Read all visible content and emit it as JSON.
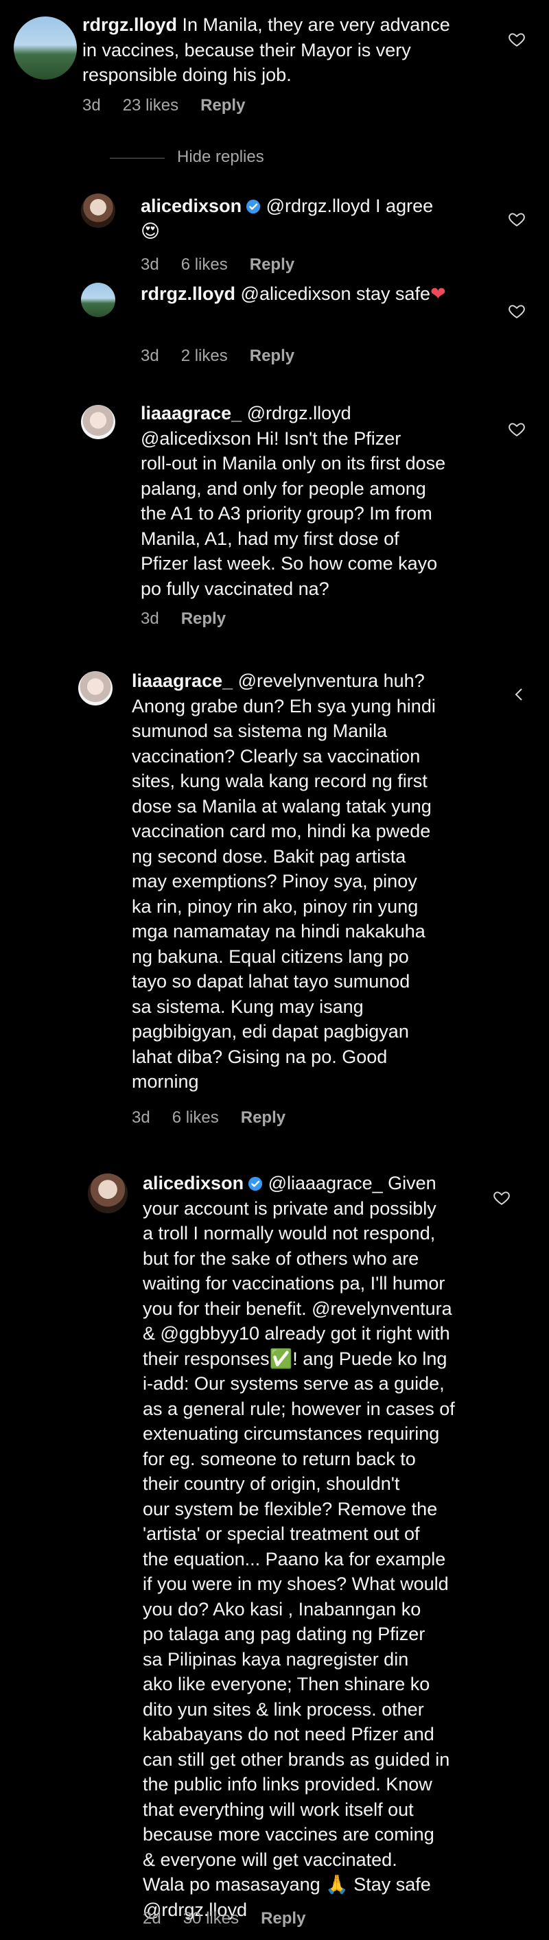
{
  "comments": [
    {
      "username": "rdrgz.lloyd",
      "lines": [
        "In Manila, they are very advance",
        "in vaccines, because their Mayor is very",
        "responsible doing his job."
      ],
      "time": "3d",
      "likes": "23 likes",
      "reply": "Reply",
      "avatar": "landscape"
    },
    {
      "username": "alicedixson",
      "mention_line": "@rdrgz.lloyd I agree",
      "emoji": "😍",
      "time": "3d",
      "likes": "6 likes",
      "reply": "Reply",
      "avatar": "face",
      "verified": true
    },
    {
      "username": "rdrgz.lloyd",
      "text": "@alicedixson stay safe",
      "emoji": "❤",
      "time": "3d",
      "likes": "2 likes",
      "reply": "Reply",
      "avatar": "landscape"
    },
    {
      "username": "liaaagrace_",
      "first_line": "@rdrgz.lloyd",
      "lines": [
        "@alicedixson  Hi! Isn't the Pfizer",
        "roll-out in Manila only on its first dose",
        "palang, and only for people among",
        "the A1 to A3 priority group? Im from",
        "Manila, A1, had my first dose of",
        "Pfizer last week. So how come kayo",
        "po fully vaccinated na?"
      ],
      "time": "3d",
      "reply": "Reply",
      "avatar": "girl"
    },
    {
      "username": "liaaagrace_",
      "first_line": "@revelynventura huh?",
      "lines": [
        "Anong grabe dun? Eh sya yung hindi",
        "sumunod sa sistema ng Manila",
        "vaccination? Clearly sa vaccination",
        "sites, kung wala kang record ng first",
        "dose sa Manila at walang tatak yung",
        "vaccination card mo, hindi ka pwede",
        "ng second dose. Bakit pag artista",
        "may exemptions? Pinoy sya, pinoy",
        "ka rin, pinoy rin ako, pinoy rin yung",
        "mga namamatay na hindi nakakuha",
        "ng bakuna. Equal citizens lang po",
        "tayo so dapat lahat tayo sumunod",
        "sa sistema. Kung may isang",
        "pagbibigyan, edi dapat pagbigyan",
        "lahat diba? Gising na po. Good",
        "morning"
      ],
      "time": "3d",
      "likes": "6 likes",
      "reply": "Reply",
      "avatar": "girl"
    },
    {
      "username": "alicedixson",
      "first_line": "@liaaagrace_  Given",
      "lines": [
        "your account is private and possibly",
        "a troll I normally would not respond,",
        "but for the sake of others who are",
        "waiting for vaccinations pa, I'll humor",
        "you for their benefit. @revelynventura",
        "& @ggbbyy10 already got it right with",
        "their responses✅! ang Puede ko lng",
        "i-add: Our systems serve as a guide,",
        "as a general rule; however in cases of",
        "extenuating circumstances requiring",
        "for eg. someone to return back to",
        "their country of origin, shouldn't",
        "our system be flexible? Remove the",
        "'artista' or special treatment out of",
        "the equation... Paano ka for example",
        "if you were in my shoes? What would",
        "you do? Ako kasi , Inabanngan ko",
        "po talaga ang pag dating ng Pfizer",
        "sa Pilipinas kaya nagregister din",
        "ako like everyone; Then shinare ko",
        "dito yun sites & link process. other",
        "kababayans do not need Pfizer and",
        "can still get other brands as guided in",
        "the public info links provided. Know",
        "that everything will work itself out",
        "because more vaccines are coming",
        "& everyone will get vaccinated.",
        "Wala po masasayang 🙏 Stay safe",
        "@rdrgz.lloyd"
      ],
      "time": "2d",
      "likes": "30 likes",
      "reply": "Reply",
      "avatar": "face",
      "verified": true
    }
  ],
  "hide_replies": "Hide replies",
  "colors": {
    "background": "#000000",
    "text": "#f5f5f5",
    "muted": "#a8a8a8",
    "verified": "#3897f0",
    "heart": "#ed4956"
  },
  "icons": {
    "like": "heart-outline-icon",
    "verified": "verified-badge-icon"
  }
}
